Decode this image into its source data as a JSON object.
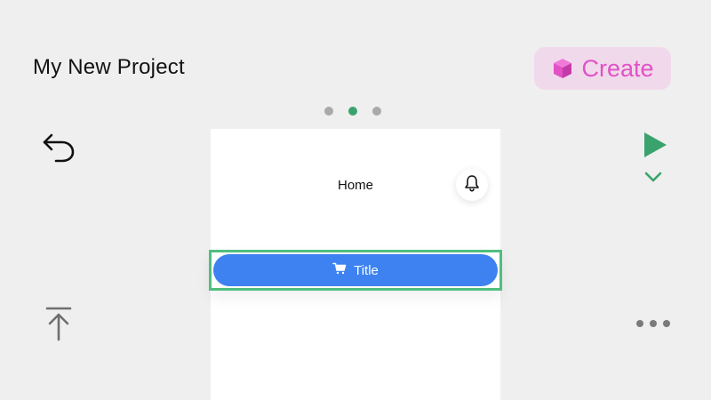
{
  "header": {
    "project_title": "My New Project",
    "create_label": "Create"
  },
  "pager": {
    "count": 3,
    "active_index": 1
  },
  "canvas": {
    "screen_title": "Home",
    "button_label": "Title"
  },
  "colors": {
    "background": "#efefef",
    "create_bg": "#f1d9ec",
    "create_text": "#e052c5",
    "accent_green": "#3aa36d",
    "selection_border": "#4fbf7f",
    "button_blue": "#3d82f0"
  },
  "icons": {
    "create": "cube-icon",
    "undo": "undo-icon",
    "play": "play-icon",
    "expand": "chevron-down-icon",
    "upload": "upload-icon",
    "more": "more-horizontal-icon",
    "notifications": "bell-icon",
    "cart": "cart-icon"
  }
}
